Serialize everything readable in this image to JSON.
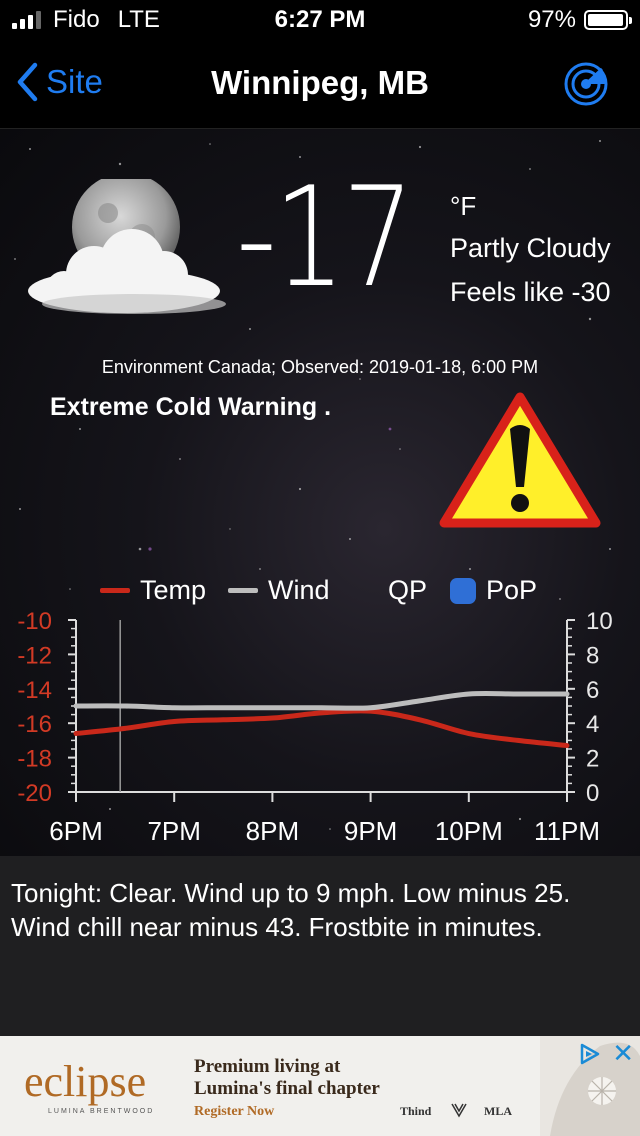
{
  "status_bar": {
    "carrier": "Fido",
    "network": "LTE",
    "time": "6:27 PM",
    "battery": "97%",
    "battery_level": 0.97,
    "signal_bars": 3
  },
  "nav": {
    "back_label": "Site",
    "title": "Winnipeg, MB",
    "radar_icon": "radar-icon"
  },
  "current": {
    "temperature": "-17",
    "unit": "°F",
    "condition": "Partly Cloudy",
    "feels_like": "Feels like -30",
    "icon": "moon-cloud-icon",
    "observed": "Environment Canada; Observed: 2019-01-18, 6:00 PM",
    "warning": "Extreme Cold Warning .",
    "warning_icon": "warning-triangle-icon"
  },
  "legend": {
    "temp": "Temp",
    "wind": "Wind",
    "qp": "QP",
    "pop": "PoP"
  },
  "colors": {
    "temp": "#c9281a",
    "wind": "#bdbdbd",
    "pop": "#2f6fd6",
    "accent": "#1f7cf0",
    "left_axis": "#d23a25"
  },
  "chart_data": {
    "type": "line",
    "categories": [
      "6PM",
      "7PM",
      "8PM",
      "9PM",
      "10PM",
      "11PM"
    ],
    "x": [
      0,
      0.5,
      1,
      1.5,
      2,
      2.5,
      3,
      3.5,
      4,
      4.5,
      5
    ],
    "series": [
      {
        "name": "Temp",
        "axis": "left",
        "values": [
          -16.6,
          -16.3,
          -15.9,
          -15.8,
          -15.7,
          -15.4,
          -15.3,
          -15.8,
          -16.6,
          -17.0,
          -17.3
        ]
      },
      {
        "name": "Wind",
        "axis": "right",
        "values": [
          5.0,
          5.0,
          4.9,
          4.9,
          4.9,
          4.9,
          4.9,
          5.3,
          5.7,
          5.7,
          5.7
        ]
      }
    ],
    "left_axis": {
      "ticks": [
        "-10",
        "-12",
        "-14",
        "-16",
        "-18",
        "-20"
      ],
      "ylim": [
        -20,
        -10
      ]
    },
    "right_axis": {
      "ticks": [
        "10",
        "8",
        "6",
        "4",
        "2",
        "0"
      ],
      "ylim": [
        0,
        10
      ]
    },
    "current_time_x": 0.45,
    "grid": false,
    "legend_position": "top"
  },
  "forecast": {
    "text": "Tonight:  Clear. Wind up to 9 mph. Low minus 25. Wind chill near minus 43. Frostbite in minutes."
  },
  "ad": {
    "brand": "eclipse",
    "brand_sub": "LUMINA BRENTWOOD",
    "headline_1": "Premium living at",
    "headline_2": "Lumina's final chapter",
    "cta": "Register Now",
    "partner_1": "Thind",
    "partner_2": "MLA",
    "adchoices_icon": "adchoices-icon",
    "close_icon": "close-icon"
  }
}
